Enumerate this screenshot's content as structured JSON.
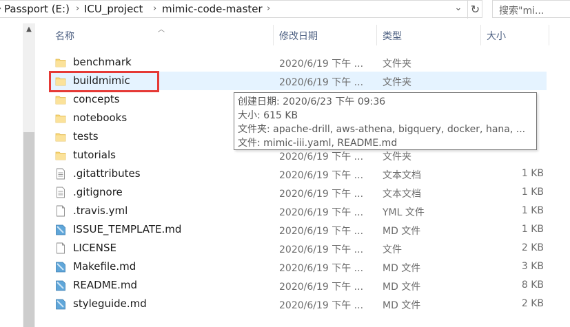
{
  "address_bar": {
    "crumbs": [
      "Passport (E:)",
      "ICU_project",
      "mimic-code-master"
    ],
    "search_placeholder": "搜索\"mi..."
  },
  "columns": {
    "name": "名称",
    "date": "修改日期",
    "type": "类型",
    "size": "大小"
  },
  "files": [
    {
      "name": "benchmark",
      "date": "2020/6/19 下午 ...",
      "type": "文件夹",
      "size": "",
      "icon": "folder-icon"
    },
    {
      "name": "buildmimic",
      "date": "2020/6/19 下午 ...",
      "type": "文件夹",
      "size": "",
      "icon": "folder-icon"
    },
    {
      "name": "concepts",
      "date": "",
      "type": "",
      "size": "",
      "icon": "folder-icon"
    },
    {
      "name": "notebooks",
      "date": "",
      "type": "",
      "size": "",
      "icon": "folder-icon"
    },
    {
      "name": "tests",
      "date": "",
      "type": "",
      "size": "",
      "icon": "folder-icon"
    },
    {
      "name": "tutorials",
      "date": "2020/6/19 下午 ...",
      "type": "文件夹",
      "size": "",
      "icon": "folder-icon"
    },
    {
      "name": ".gitattributes",
      "date": "2020/6/19 下午 ...",
      "type": "文本文档",
      "size": "1 KB",
      "icon": "text-file-icon"
    },
    {
      "name": ".gitignore",
      "date": "2020/6/19 下午 ...",
      "type": "文本文档",
      "size": "1 KB",
      "icon": "text-file-icon"
    },
    {
      "name": ".travis.yml",
      "date": "2020/6/19 下午 ...",
      "type": "YML 文件",
      "size": "1 KB",
      "icon": "blank-file-icon"
    },
    {
      "name": "ISSUE_TEMPLATE.md",
      "date": "2020/6/19 下午 ...",
      "type": "MD 文件",
      "size": "1 KB",
      "icon": "md-file-icon"
    },
    {
      "name": "LICENSE",
      "date": "2020/6/19 下午 ...",
      "type": "文件",
      "size": "2 KB",
      "icon": "blank-file-icon"
    },
    {
      "name": "Makefile.md",
      "date": "2020/6/19 下午 ...",
      "type": "MD 文件",
      "size": "3 KB",
      "icon": "md-file-icon"
    },
    {
      "name": "README.md",
      "date": "2020/6/19 下午 ...",
      "type": "MD 文件",
      "size": "8 KB",
      "icon": "md-file-icon"
    },
    {
      "name": "styleguide.md",
      "date": "2020/6/19 下午 ...",
      "type": "MD 文件",
      "size": "2 KB",
      "icon": "md-file-icon"
    }
  ],
  "tooltip": {
    "line1": "创建日期: 2020/6/23 下午 09:36",
    "line2": "大小: 615 KB",
    "line3": "文件夹: apache-drill, aws-athena, bigquery, docker, hana, ...",
    "line4": "文件: mimic-iii.yaml, README.md"
  },
  "colors": {
    "hover_row": "#e5f3ff",
    "highlight_box": "#e53935",
    "folder": "#f8d775",
    "header_text": "#4d6082"
  }
}
